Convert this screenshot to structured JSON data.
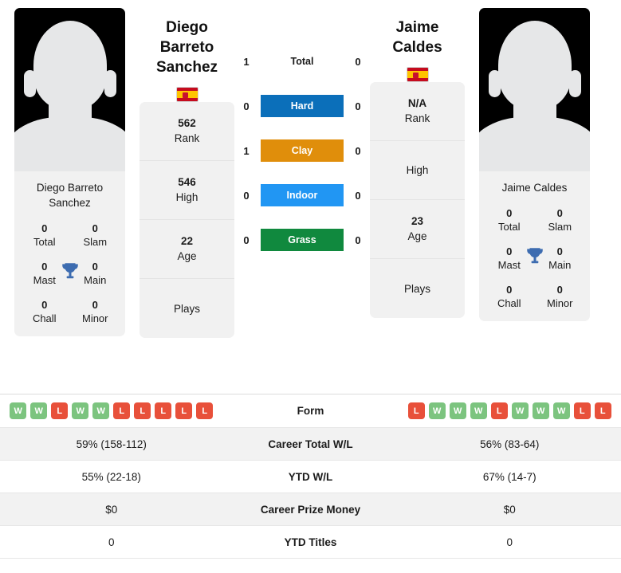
{
  "players": {
    "left": {
      "name": "Diego Barreto Sanchez",
      "card_name": "Diego Barreto Sanchez",
      "flag": "spain-flag",
      "rank": "562",
      "rank_label": "Rank",
      "high": "546",
      "high_label": "High",
      "age": "22",
      "age_label": "Age",
      "plays": "",
      "plays_label": "Plays",
      "titles": {
        "total": "0",
        "total_label": "Total",
        "slam": "0",
        "slam_label": "Slam",
        "mast": "0",
        "mast_label": "Mast",
        "main": "0",
        "main_label": "Main",
        "chall": "0",
        "chall_label": "Chall",
        "minor": "0",
        "minor_label": "Minor"
      },
      "form": [
        "W",
        "W",
        "L",
        "W",
        "W",
        "L",
        "L",
        "L",
        "L",
        "L"
      ],
      "career_wl": "59% (158-112)",
      "ytd_wl": "55% (22-18)",
      "prize_money": "$0",
      "ytd_titles": "0"
    },
    "right": {
      "name": "Jaime Caldes",
      "card_name": "Jaime Caldes",
      "flag": "spain-flag",
      "rank": "N/A",
      "rank_label": "Rank",
      "high": "",
      "high_label": "High",
      "age": "23",
      "age_label": "Age",
      "plays": "",
      "plays_label": "Plays",
      "titles": {
        "total": "0",
        "total_label": "Total",
        "slam": "0",
        "slam_label": "Slam",
        "mast": "0",
        "mast_label": "Mast",
        "main": "0",
        "main_label": "Main",
        "chall": "0",
        "chall_label": "Chall",
        "minor": "0",
        "minor_label": "Minor"
      },
      "form": [
        "L",
        "W",
        "W",
        "W",
        "L",
        "W",
        "W",
        "W",
        "L",
        "L"
      ],
      "career_wl": "56% (83-64)",
      "ytd_wl": "67% (14-7)",
      "prize_money": "$0",
      "ytd_titles": "0"
    }
  },
  "surfaces": [
    {
      "label": "Total",
      "left": "1",
      "right": "0",
      "color": "transparent",
      "filled": false
    },
    {
      "label": "Hard",
      "left": "0",
      "right": "0",
      "color": "#0b6fba",
      "filled": true
    },
    {
      "label": "Clay",
      "left": "1",
      "right": "0",
      "color": "#e08e0b",
      "filled": true
    },
    {
      "label": "Indoor",
      "left": "0",
      "right": "0",
      "color": "#2196f3",
      "filled": true
    },
    {
      "label": "Grass",
      "left": "0",
      "right": "0",
      "color": "#10893e",
      "filled": true
    }
  ],
  "table": {
    "rows": [
      {
        "label": "Form",
        "type": "form",
        "left": "",
        "right": ""
      },
      {
        "label": "Career Total W/L",
        "type": "text",
        "left": "59% (158-112)",
        "right": "56% (83-64)"
      },
      {
        "label": "YTD W/L",
        "type": "text",
        "left": "55% (22-18)",
        "right": "67% (14-7)"
      },
      {
        "label": "Career Prize Money",
        "type": "text",
        "left": "$0",
        "right": "$0"
      },
      {
        "label": "YTD Titles",
        "type": "text",
        "left": "0",
        "right": "0"
      }
    ]
  },
  "colors": {
    "hard": "#0b6fba",
    "clay": "#e08e0b",
    "indoor": "#2196f3",
    "grass": "#10893e",
    "win_badge": "#7cc47f",
    "loss_badge": "#e8503a",
    "card_bg": "#f1f1f1"
  }
}
